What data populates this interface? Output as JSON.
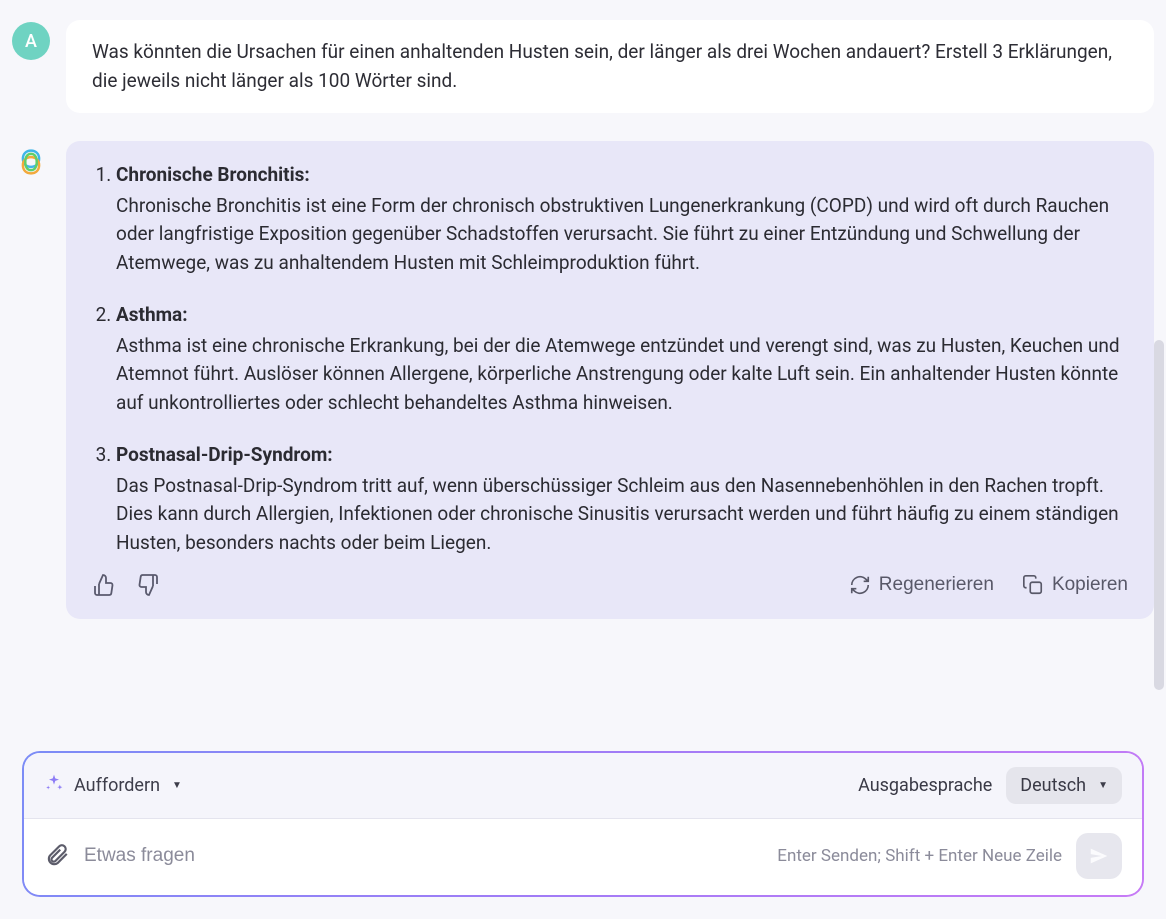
{
  "user": {
    "avatar_letter": "A",
    "message": "Was könnten die Ursachen für einen anhaltenden Husten sein, der länger als drei Wochen andauert? Erstell 3 Erklärungen, die jeweils nicht länger als 100 Wörter sind."
  },
  "assistant": {
    "items": [
      {
        "title": "Chronische Bronchitis:",
        "body": "Chronische Bronchitis ist eine Form der chronisch obstruktiven Lungenerkrankung (COPD) und wird oft durch Rauchen oder langfristige Exposition gegenüber Schadstoffen verursacht. Sie führt zu einer Entzündung und Schwellung der Atemwege, was zu anhaltendem Husten mit Schleimproduktion führt."
      },
      {
        "title": "Asthma:",
        "body": "Asthma ist eine chronische Erkrankung, bei der die Atemwege entzündet und verengt sind, was zu Husten, Keuchen und Atemnot führt. Auslöser können Allergene, körperliche Anstrengung oder kalte Luft sein. Ein anhaltender Husten könnte auf unkontrolliertes oder schlecht behandeltes Asthma hinweisen."
      },
      {
        "title": "Postnasal-Drip-Syndrom:",
        "body": "Das Postnasal-Drip-Syndrom tritt auf, wenn überschüssiger Schleim aus den Nasennebenhöhlen in den Rachen tropft. Dies kann durch Allergien, Infektionen oder chronische Sinusitis verursacht werden und führt häufig zu einem ständigen Husten, besonders nachts oder beim Liegen."
      }
    ]
  },
  "actions": {
    "regenerate": "Regenerieren",
    "copy": "Kopieren"
  },
  "input": {
    "mode_label": "Auffordern",
    "output_lang_label": "Ausgabesprache",
    "output_lang_value": "Deutsch",
    "placeholder": "Etwas fragen",
    "hint": "Enter Senden; Shift + Enter Neue Zeile"
  }
}
